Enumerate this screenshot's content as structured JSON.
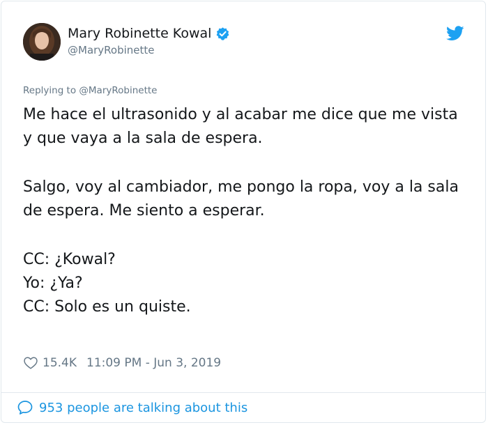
{
  "author": {
    "display_name": "Mary Robinette Kowal",
    "handle": "@MaryRobinette",
    "avatar_icon": "avatar-photo",
    "verified_icon": "verified-badge-icon"
  },
  "platform_icon": "twitter-bird-icon",
  "reply": {
    "prefix": "Replying to ",
    "mention": "@MaryRobinette"
  },
  "tweet": {
    "lines": [
      "Me hace el ultrasonido y al acabar me dice que me vista y que vaya a la sala de espera.",
      "Salgo, voy al cambiador, me pongo la ropa, voy a la sala de espera. Me siento a esperar.",
      "CC: ¿Kowal?",
      "Yo: ¿Ya?",
      "CC: Solo es un quiste."
    ]
  },
  "meta": {
    "likes": "15.4K",
    "timestamp": "11:09 PM - Jun 3, 2019"
  },
  "footer": {
    "talking_text": "953 people are talking about this"
  },
  "colors": {
    "accent": "#1da1f2",
    "link": "#1b95e0",
    "muted": "#657786",
    "text": "#14171a",
    "border": "#e1e8ed"
  }
}
